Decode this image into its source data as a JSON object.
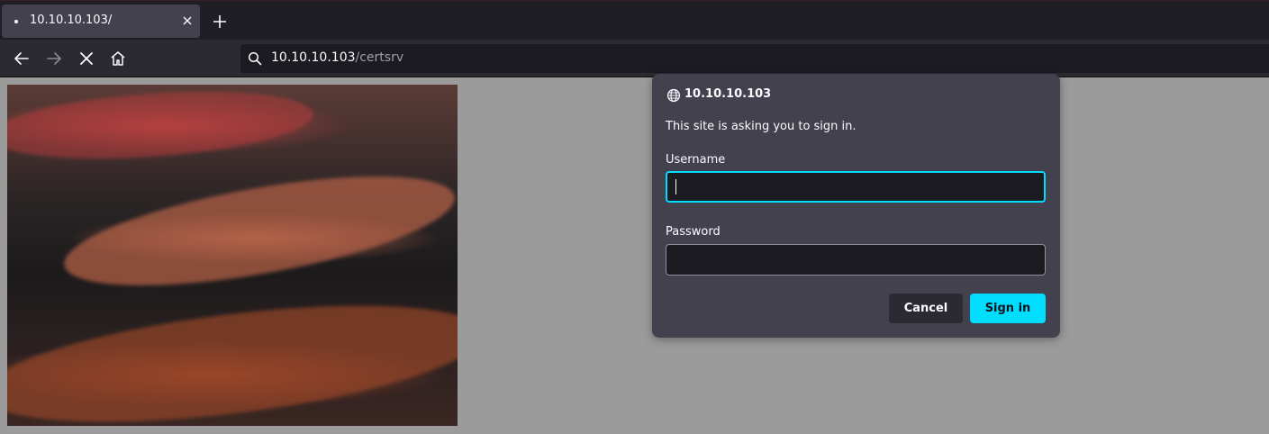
{
  "tab": {
    "title": "10.10.10.103/",
    "close_icon": "close-icon",
    "new_tab_icon": "plus-icon"
  },
  "nav": {
    "back_icon": "arrow-left-icon",
    "forward_icon": "arrow-right-icon",
    "stop_icon": "close-icon",
    "home_icon": "home-icon"
  },
  "urlbar": {
    "icon": "search-icon",
    "host": "10.10.10.103",
    "path": "/certsrv"
  },
  "dialog": {
    "host_icon": "globe-icon",
    "host": "10.10.10.103",
    "message": "This site is asking you to sign in.",
    "username_label": "Username",
    "username_value": "",
    "password_label": "Password",
    "password_value": "",
    "cancel_label": "Cancel",
    "signin_label": "Sign in"
  },
  "colors": {
    "accent": "#00ddff",
    "dialog_bg": "#42414d",
    "toolbar_bg": "#2b2a33"
  }
}
